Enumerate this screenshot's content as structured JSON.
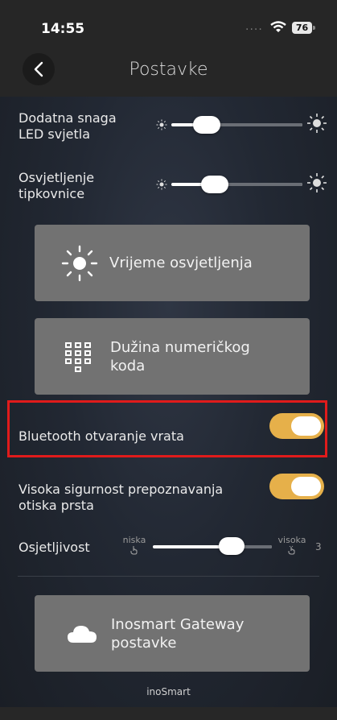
{
  "status_bar": {
    "time": "14:55",
    "signal": "....",
    "battery": "76"
  },
  "header": {
    "title": "Postavke"
  },
  "led": {
    "label_line1": "Dodatna snaga",
    "label_line2": "LED svjetla",
    "level": 0.3
  },
  "keyboard": {
    "label_line1": "Osvjetljenje",
    "label_line2": "tipkovnice",
    "level": 0.36
  },
  "cards": {
    "light_time": "Vrijeme osvjetljenja",
    "code_length_line1": "Dužina  numeričkog",
    "code_length_line2": "koda",
    "gateway_line1": "Inosmart Gateway",
    "gateway_line2": "postavke"
  },
  "bluetooth": {
    "label": "Bluetooth otvaranje vrata",
    "on": true
  },
  "fingerprint": {
    "label_line1": "Visoka sigurnost prepoznavanja",
    "label_line2": "otiska prsta",
    "on": true
  },
  "sensitivity": {
    "label": "Osjetljivost",
    "low": "niska",
    "high": "visoka",
    "value": "3",
    "level": 0.6
  },
  "footer": {
    "brand": "inoSmart"
  }
}
